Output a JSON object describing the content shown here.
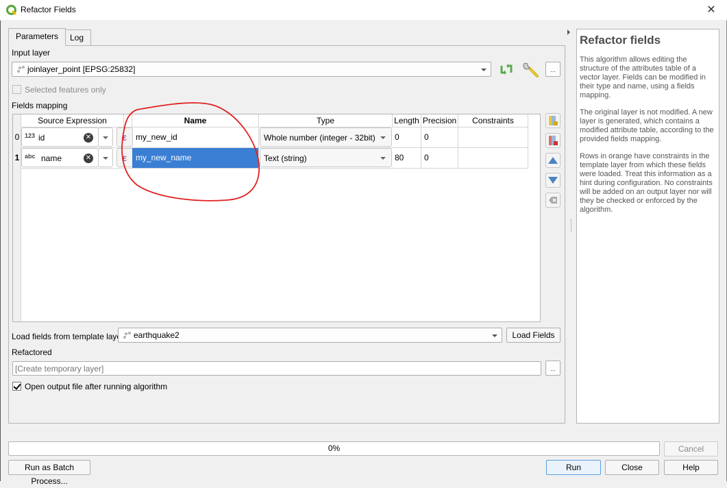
{
  "window": {
    "title": "Refactor Fields",
    "close_label": "✕"
  },
  "tabs": [
    {
      "label": "Parameters",
      "active": true
    },
    {
      "label": "Log",
      "active": false
    }
  ],
  "input_layer": {
    "label": "Input layer",
    "value": "joinlayer_point [EPSG:25832]",
    "ellipsis_label": "..."
  },
  "selected_features_only": {
    "label": "Selected features only",
    "checked": false,
    "enabled": false
  },
  "fields_mapping": {
    "label": "Fields mapping",
    "columns": [
      "Source Expression",
      "Name",
      "Type",
      "Length",
      "Precision",
      "Constraints"
    ],
    "rows": [
      {
        "index": "0",
        "source_kind": "123",
        "source": "id",
        "name": "my_new_id",
        "type": "Whole number (integer - 32bit)",
        "length": "0",
        "precision": "0",
        "constraints": "",
        "selected": false
      },
      {
        "index": "1",
        "source_kind": "abc",
        "source": "name",
        "name": "my_new_name",
        "type": "Text (string)",
        "length": "80",
        "precision": "0",
        "constraints": "",
        "selected": true
      }
    ],
    "expression_symbol": "ε",
    "clear_symbol": "✕",
    "side_buttons": [
      "add-field",
      "delete-field",
      "move-up",
      "move-down",
      "reset"
    ]
  },
  "template_layer": {
    "label": "Load fields from template layer",
    "value": "earthquake2",
    "load_button": "Load Fields"
  },
  "refactored": {
    "label": "Refactored",
    "placeholder": "[Create temporary layer]",
    "ellipsis_label": "..."
  },
  "open_output": {
    "label": "Open output file after running algorithm",
    "checked": true
  },
  "help": {
    "title": "Refactor fields",
    "paragraphs": [
      "This algorithm allows editing the structure of the attributes table of a vector layer. Fields can be modified in their type and name, using a fields mapping.",
      "The original layer is not modified. A new layer is generated, which contains a modified attribute table, according to the provided fields mapping.",
      "Rows in orange have constraints in the template layer from which these fields were loaded. Treat this information as a hint during configuration. No constraints will be added on an output layer nor will they be checked or enforced by the algorithm."
    ]
  },
  "progress": {
    "value_percent": 0,
    "label": "0%"
  },
  "buttons": {
    "batch": "Run as Batch Process...",
    "cancel": "Cancel",
    "run": "Run",
    "close": "Close",
    "help": "Help"
  },
  "colors": {
    "selection": "#3b7fd4",
    "annotation": "#e02020",
    "refresh_icon": "#5aaa52"
  }
}
